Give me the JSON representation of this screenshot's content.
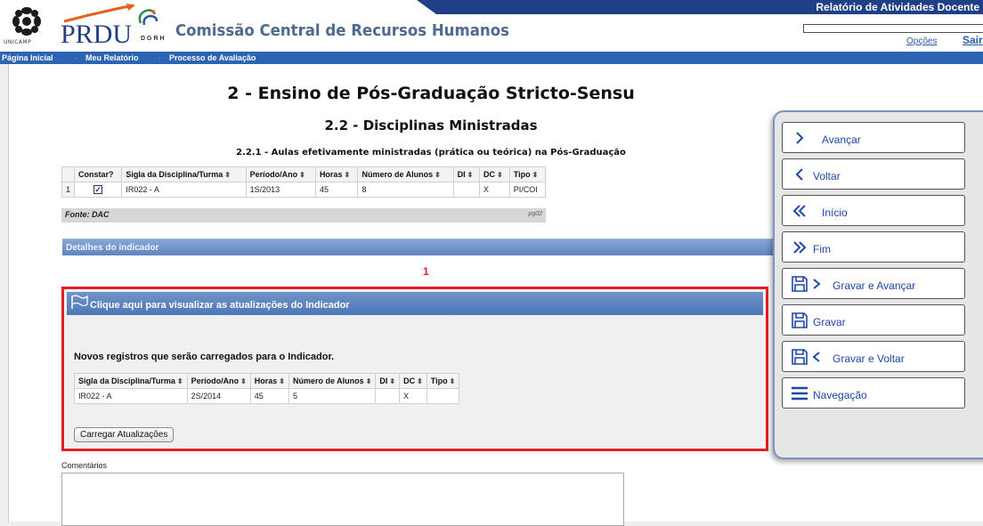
{
  "header": {
    "logo_caption": "UNICAMP",
    "prdu": "PRDU",
    "dgrh": "DGRH",
    "app_title": "Comissão Central de Recursos Humanos",
    "report_title": "Relatório de Atividades Docente",
    "opcoes": "Opções",
    "sair": "Sair"
  },
  "nav": {
    "items": [
      "Página Inicial",
      "Meu Relatório",
      "Processo de Avaliação"
    ]
  },
  "page": {
    "title": "2 - Ensino de Pós-Graduação Stricto-Sensu",
    "section": "2.2 - Disciplinas Ministradas",
    "subtitle": "2.2.1 - Aulas efetivamente ministradas (prática ou teórica) na Pós-Graduação"
  },
  "table1": {
    "headers": [
      "Constar?",
      "Sigla da Disciplina/Turma",
      "Período/Ano",
      "Horas",
      "Número de Alunos",
      "DI",
      "DC",
      "Tipo"
    ],
    "rows": [
      {
        "num": "1",
        "checked": true,
        "sigla": "IR022 - A",
        "periodo": "1S/2013",
        "horas": "45",
        "alunos": "8",
        "di": "",
        "dc": "X",
        "tipo": "PI/COI"
      }
    ],
    "fonte": "Fonte: DAC",
    "code": "pg02"
  },
  "detalhes": {
    "label": "Detalhes do indicador"
  },
  "marker": "1",
  "updates": {
    "bar_label": "Clique aqui para visualizar as atualizações do Indicador",
    "novos_label": "Novos registros que serão carregados para o Indicador.",
    "headers": [
      "Sigla da Disciplina/Turma",
      "Período/Ano",
      "Horas",
      "Número de Alunos",
      "DI",
      "DC",
      "Tipo"
    ],
    "rows": [
      {
        "sigla": "IR022 - A",
        "periodo": "2S/2014",
        "horas": "45",
        "alunos": "5",
        "di": "",
        "dc": "X",
        "tipo": ""
      }
    ],
    "button": "Carregar Atualizações"
  },
  "comentarios": {
    "label": "Comentários",
    "value": ""
  },
  "side_panel": {
    "buttons": [
      {
        "label": "Avançar",
        "icon": "chevron-right-icon"
      },
      {
        "label": "Voltar",
        "icon": "chevron-left-icon"
      },
      {
        "label": "Início",
        "icon": "double-chevron-left-icon"
      },
      {
        "label": "Fim",
        "icon": "double-chevron-right-icon"
      },
      {
        "label": "Gravar e Avançar",
        "icon": "save-forward-icon"
      },
      {
        "label": "Gravar",
        "icon": "save-icon"
      },
      {
        "label": "Gravar e Voltar",
        "icon": "save-back-icon"
      },
      {
        "label": "Navegação",
        "icon": "menu-icon"
      }
    ]
  },
  "colors": {
    "nav_blue": "#2b63b5",
    "highlight_red": "#e41e26",
    "link_blue": "#1e47a8"
  }
}
